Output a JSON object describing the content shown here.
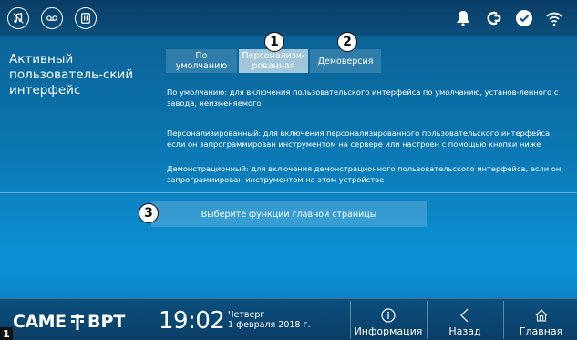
{
  "header": {
    "icons": [
      "music-mute-icon",
      "voicemail-icon",
      "intercom-icon"
    ],
    "status_icons": [
      "bell-icon",
      "sync-icon",
      "check-icon",
      "wifi-icon"
    ]
  },
  "settings": {
    "title": "Активный пользователь-ский интерфейс",
    "tabs": [
      {
        "label": "По умолчанию",
        "active": false
      },
      {
        "label": "Персонализи-рованная",
        "active": true
      },
      {
        "label": "Демоверсия",
        "active": false
      }
    ],
    "descriptions": [
      "По умолчанию: для включения пользовательского интерфейса по умолчанию, установ-ленного с завода, неизменяемого",
      "Персонализированный: для включения персонализированного пользовательского интерфейса, если он запрограммирован инструментом на сервере или настроен с помощью кнопки ниже",
      "Демонстрационный: для включения демонстрационного пользовательского интерфейса, если он запрограммирован инструментом на этом устройстве"
    ],
    "home_functions_button": "Выберите функции главной страницы"
  },
  "callouts": {
    "one": "1",
    "two": "2",
    "three": "3",
    "corner": "1"
  },
  "footer": {
    "brand1": "CAME",
    "brand2": "BPT",
    "time": "19:02",
    "day": "Четверг",
    "date": "1 февраля 2018 г.",
    "info_label": "Информация",
    "back_label": "Назад",
    "home_label": "Главная"
  },
  "colors": {
    "accent": "#0d93d8",
    "topbar": "#0a3e66",
    "tab_active": "#9ec8e2"
  }
}
